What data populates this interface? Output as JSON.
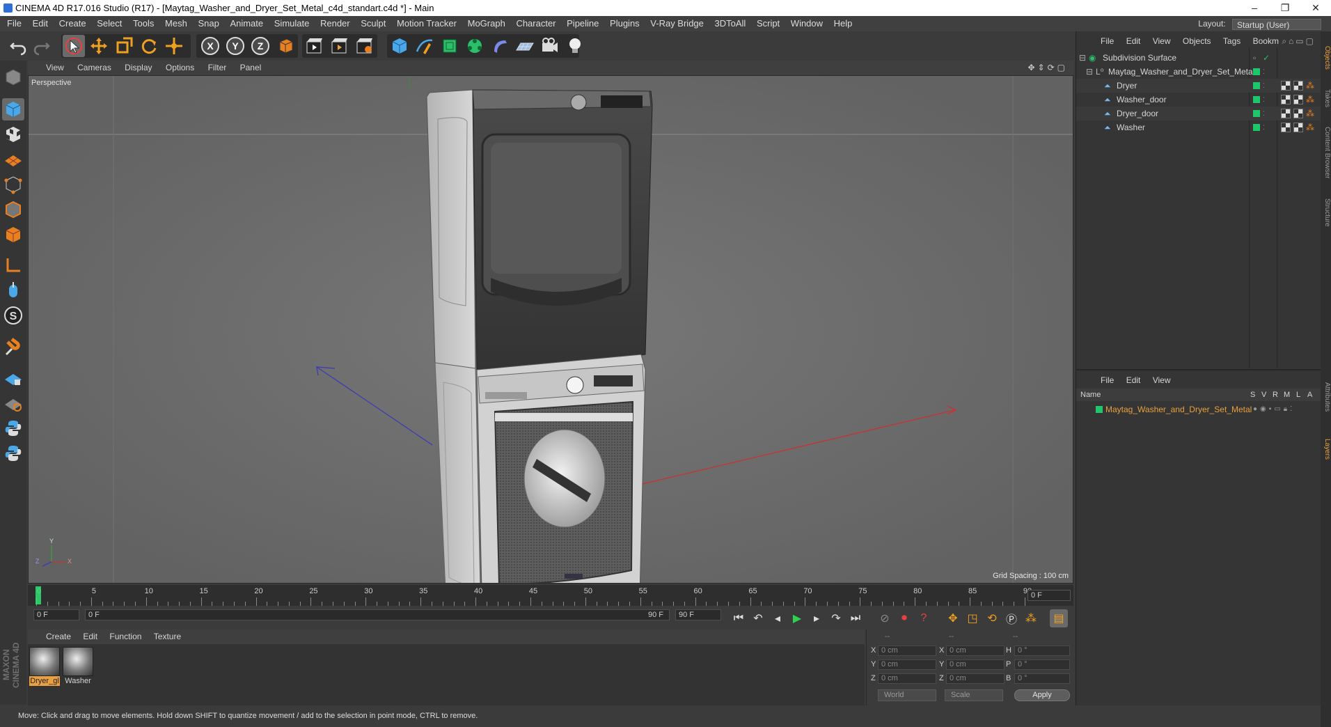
{
  "window": {
    "title": "CINEMA 4D R17.016 Studio (R17) - [Maytag_Washer_and_Dryer_Set_Metal_c4d_standart.c4d *] - Main",
    "controls": [
      "–",
      "❐",
      "✕"
    ]
  },
  "menubar": {
    "items": [
      "File",
      "Edit",
      "Create",
      "Select",
      "Tools",
      "Mesh",
      "Snap",
      "Animate",
      "Simulate",
      "Render",
      "Sculpt",
      "Motion Tracker",
      "MoGraph",
      "Character",
      "Pipeline",
      "Plugins",
      "V-Ray Bridge",
      "3DToAll",
      "Script",
      "Window",
      "Help"
    ],
    "layout_label": "Layout:",
    "layout_value": "Startup (User)"
  },
  "viewport": {
    "menu": [
      "View",
      "Cameras",
      "Display",
      "Options",
      "Filter",
      "Panel"
    ],
    "camera_label": "Perspective",
    "grid_spacing": "Grid Spacing : 100 cm",
    "axis_labels": {
      "x": "X",
      "y": "Y",
      "z": "Z"
    }
  },
  "timeline": {
    "ticks": [
      0,
      5,
      10,
      15,
      20,
      25,
      30,
      35,
      40,
      45,
      50,
      55,
      60,
      65,
      70,
      75,
      80,
      85,
      90
    ],
    "current_frame": "0 F",
    "start_field": "0 F",
    "range_start": "0 F",
    "range_end": "90 F",
    "end_field": "90 F"
  },
  "materials": {
    "menu": [
      "Create",
      "Edit",
      "Function",
      "Texture"
    ],
    "items": [
      {
        "label": "Dryer_gl",
        "selected": true
      },
      {
        "label": "Washer",
        "selected": false
      }
    ]
  },
  "coordinates": {
    "headers": [
      "--",
      "--",
      "--"
    ],
    "rows": [
      {
        "a": "X",
        "av": "0 cm",
        "b": "X",
        "bv": "0 cm",
        "c": "H",
        "cv": "0 °"
      },
      {
        "a": "Y",
        "av": "0 cm",
        "b": "Y",
        "bv": "0 cm",
        "c": "P",
        "cv": "0 °"
      },
      {
        "a": "Z",
        "av": "0 cm",
        "b": "Z",
        "bv": "0 cm",
        "c": "B",
        "cv": "0 °"
      }
    ],
    "mode": "World",
    "scale": "Scale",
    "apply": "Apply"
  },
  "status": "Move: Click and drag to move elements. Hold down SHIFT to quantize movement / add to the selection in point mode, CTRL to remove.",
  "object_manager": {
    "menu": [
      "File",
      "Edit",
      "View",
      "Objects",
      "Tags",
      "Bookm"
    ],
    "objects": [
      {
        "name": "Subdivision Surface",
        "level": 0
      },
      {
        "name": "Maytag_Washer_and_Dryer_Set_Metal",
        "level": 1
      },
      {
        "name": "Dryer",
        "level": 2
      },
      {
        "name": "Washer_door",
        "level": 2
      },
      {
        "name": "Dryer_door",
        "level": 2
      },
      {
        "name": "Washer",
        "level": 2
      }
    ]
  },
  "layer_manager": {
    "menu": [
      "File",
      "Edit",
      "View"
    ],
    "columns": [
      "Name",
      "S",
      "V",
      "R",
      "M",
      "L",
      "A"
    ],
    "layers": [
      {
        "name": "Maytag_Washer_and_Dryer_Set_Metal"
      }
    ]
  },
  "right_tabs": [
    "Objects",
    "Takes",
    "Content Browser",
    "Structure",
    "Attributes",
    "Layers"
  ],
  "branding": "MAXON CINEMA 4D",
  "colors": {
    "accent_orange": "#e8a040",
    "layer_green": "#1ec86a",
    "x_axis": "#c83232",
    "z_axis": "#3c3cb4"
  }
}
